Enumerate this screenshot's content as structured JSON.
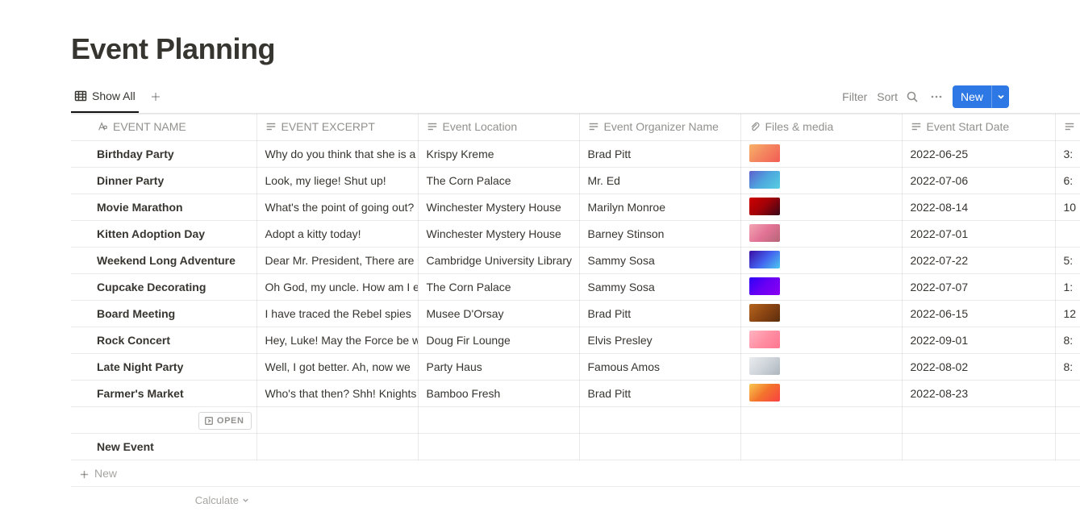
{
  "page_title": "Event Planning",
  "view": {
    "active_tab": "Show All"
  },
  "toolbar": {
    "filter_label": "Filter",
    "sort_label": "Sort",
    "new_label": "New"
  },
  "columns": [
    {
      "key": "name",
      "label": "EVENT NAME",
      "icon": "title-icon"
    },
    {
      "key": "excerpt",
      "label": "EVENT EXCERPT",
      "icon": "text-icon"
    },
    {
      "key": "loc",
      "label": "Event Location",
      "icon": "text-icon"
    },
    {
      "key": "org",
      "label": "Event Organizer Name",
      "icon": "text-icon"
    },
    {
      "key": "media",
      "label": "Files & media",
      "icon": "attachment-icon"
    },
    {
      "key": "date",
      "label": "Event Start Date",
      "icon": "text-icon"
    },
    {
      "key": "time",
      "label": "",
      "icon": "text-icon"
    }
  ],
  "rows": [
    {
      "name": "Birthday Party",
      "excerpt": "Why do you think that she is a",
      "loc": "Krispy Kreme",
      "org": "Brad Pitt",
      "media_color": "linear-gradient(135deg,#f7b267,#f4845f,#f25c54)",
      "date": "2022-06-25",
      "time": "3:"
    },
    {
      "name": "Dinner Party",
      "excerpt": "Look, my liege! Shut up!",
      "loc": "The Corn Palace",
      "org": "Mr. Ed",
      "media_color": "linear-gradient(135deg,#5e60ce,#4ea8de,#56cfe1)",
      "date": "2022-07-06",
      "time": "6:"
    },
    {
      "name": "Movie Marathon",
      "excerpt": "What's the point of going out?",
      "loc": "Winchester Mystery House",
      "org": "Marilyn Monroe",
      "media_color": "linear-gradient(135deg,#d00000,#9d0208,#370617)",
      "date": "2022-08-14",
      "time": "10"
    },
    {
      "name": "Kitten Adoption Day",
      "excerpt": "Adopt a kitty today!",
      "loc": "Winchester Mystery House",
      "org": "Barney Stinson",
      "media_color": "linear-gradient(135deg,#f4a6b4,#e27396,#b56576)",
      "date": "2022-07-01",
      "time": ""
    },
    {
      "name": "Weekend Long Adventure",
      "excerpt": "Dear Mr. President, There are",
      "loc": "Cambridge University Library",
      "org": "Sammy Sosa",
      "media_color": "linear-gradient(135deg,#3a0ca3,#4361ee,#4cc9f0)",
      "date": "2022-07-22",
      "time": "5:"
    },
    {
      "name": "Cupcake Decorating",
      "excerpt": "Oh God, my uncle. How am I e",
      "loc": "The Corn Palace",
      "org": "Sammy Sosa",
      "media_color": "linear-gradient(135deg,#2d00f7,#6a00f4,#8900f2)",
      "date": "2022-07-07",
      "time": "1:"
    },
    {
      "name": "Board Meeting",
      "excerpt": "I have traced the Rebel spies",
      "loc": "Musee D'Orsay",
      "org": "Brad Pitt",
      "media_color": "linear-gradient(135deg,#b5651d,#8b4513,#5a2d0c)",
      "date": "2022-06-15",
      "time": "12"
    },
    {
      "name": "Rock Concert",
      "excerpt": "Hey, Luke! May the Force be w",
      "loc": "Doug Fir Lounge",
      "org": "Elvis Presley",
      "media_color": "linear-gradient(135deg,#ffb3c1,#ff8fa3,#ff758f)",
      "date": "2022-09-01",
      "time": "8:"
    },
    {
      "name": "Late Night Party",
      "excerpt": "Well, I got better. Ah, now we",
      "loc": "Party Haus",
      "org": "Famous Amos",
      "media_color": "linear-gradient(135deg,#e9ecef,#ced4da,#adb5bd)",
      "date": "2022-08-02",
      "time": "8:"
    },
    {
      "name": "Farmer's Market",
      "excerpt": "Who's that then? Shh! Knights",
      "loc": "Bamboo Fresh",
      "org": "Brad Pitt",
      "media_color": "linear-gradient(135deg,#f9c74f,#f3722c,#f94144)",
      "date": "2022-08-23",
      "time": ""
    }
  ],
  "empty_row_open_label": "OPEN",
  "new_row_label_1": "New Event",
  "new_row_label_2": "New",
  "calculate_label": "Calculate"
}
